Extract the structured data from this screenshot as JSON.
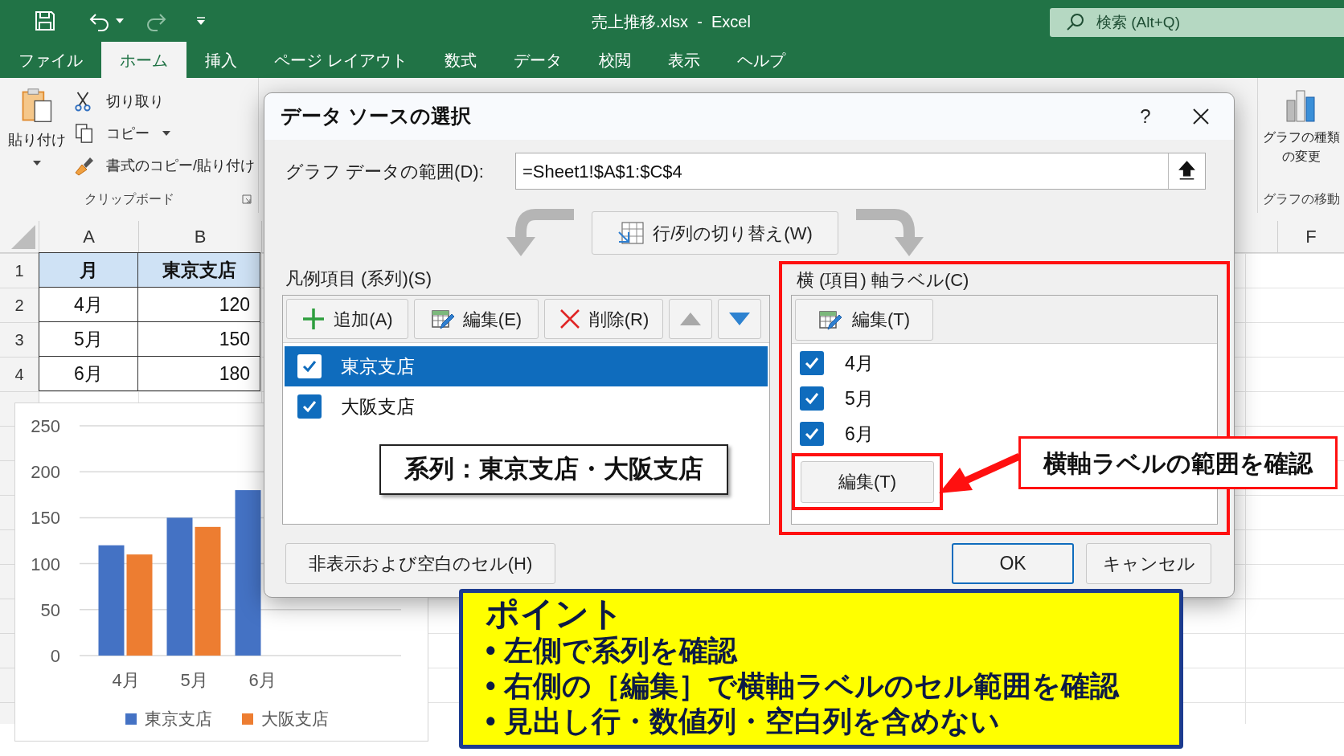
{
  "window": {
    "title": "売上推移.xlsx  -  Excel",
    "search": {
      "placeholder": "検索 (Alt+Q)"
    }
  },
  "ribbon_tabs": [
    {
      "label": "ファイル",
      "selected": false
    },
    {
      "label": "ホーム",
      "selected": true
    },
    {
      "label": "挿入",
      "selected": false
    },
    {
      "label": "ページ レイアウト",
      "selected": false
    },
    {
      "label": "数式",
      "selected": false
    },
    {
      "label": "データ",
      "selected": false
    },
    {
      "label": "校閲",
      "selected": false
    },
    {
      "label": "表示",
      "selected": false
    },
    {
      "label": "ヘルプ",
      "selected": false
    }
  ],
  "ribbon": {
    "paste": "貼り付け",
    "cut": "切り取り",
    "copy": "コピー",
    "format_painter": "書式のコピー/貼り付け",
    "clipboard_group": "クリップボード",
    "change_chart_type": "グラフの種類の変更",
    "move_chart_group": "グラフの移動"
  },
  "sheet": {
    "column_headers": [
      "A",
      "B"
    ],
    "right_column_header": "F",
    "rows": [
      {
        "number": "1",
        "highlighted": true,
        "cells": [
          "月",
          "東京支店"
        ]
      },
      {
        "number": "2",
        "highlighted": false,
        "cells": [
          "4月",
          "120"
        ]
      },
      {
        "number": "3",
        "highlighted": false,
        "cells": [
          "5月",
          "150"
        ]
      },
      {
        "number": "4",
        "highlighted": false,
        "cells": [
          "6月",
          "180"
        ]
      }
    ]
  },
  "chart": {
    "chart_data": {
      "type": "bar",
      "categories": [
        "4月",
        "5月",
        "6月"
      ],
      "series": [
        {
          "name": "東京支店",
          "color": "#4472c4",
          "values": [
            120,
            150,
            180
          ]
        },
        {
          "name": "大阪支店",
          "color": "#ed7d31",
          "values": [
            110,
            140,
            null
          ]
        }
      ],
      "ylim": [
        0,
        250
      ],
      "yticks": [
        0,
        50,
        100,
        150,
        200,
        250
      ],
      "grid": true,
      "legend": true
    }
  },
  "dialog": {
    "title": "データ ソースの選択",
    "help": "?",
    "range_label": "グラフ データの範囲(D):",
    "range_value": "=Sheet1!$A$1:$C$4",
    "switch_button": "行/列の切り替え(W)",
    "legend_section": {
      "label": "凡例項目 (系列)(S)",
      "buttons": [
        {
          "kind": "add",
          "label": "追加(A)"
        },
        {
          "kind": "edit",
          "label": "編集(E)"
        },
        {
          "kind": "delete",
          "label": "削除(R)"
        },
        {
          "kind": "up"
        },
        {
          "kind": "down"
        }
      ],
      "items": [
        {
          "label": "東京支店",
          "checked": true,
          "selected": true
        },
        {
          "label": "大阪支店",
          "checked": true,
          "selected": false
        }
      ]
    },
    "axis_section": {
      "label": "横 (項目) 軸ラベル(C)",
      "edit_button": "編集(T)",
      "items": [
        {
          "label": "4月",
          "checked": true
        },
        {
          "label": "5月",
          "checked": true
        },
        {
          "label": "6月",
          "checked": true
        }
      ],
      "highlighted_edit_button": "編集(T)"
    },
    "hidden_cells_button": "非表示および空白のセル(H)",
    "ok_button": "OK",
    "cancel_button": "キャンセル"
  },
  "annotations": {
    "series_note": "系列：東京支店・大阪支店",
    "axis_note": "横軸ラベルの範囲を確認"
  },
  "point_box": {
    "title": "ポイント",
    "bullets": [
      "• 左側で系列を確認",
      "• 右側の［編集］で横軸ラベルのセル範囲を確認",
      "• 見出し行・数値列・空白列を含めない"
    ]
  }
}
